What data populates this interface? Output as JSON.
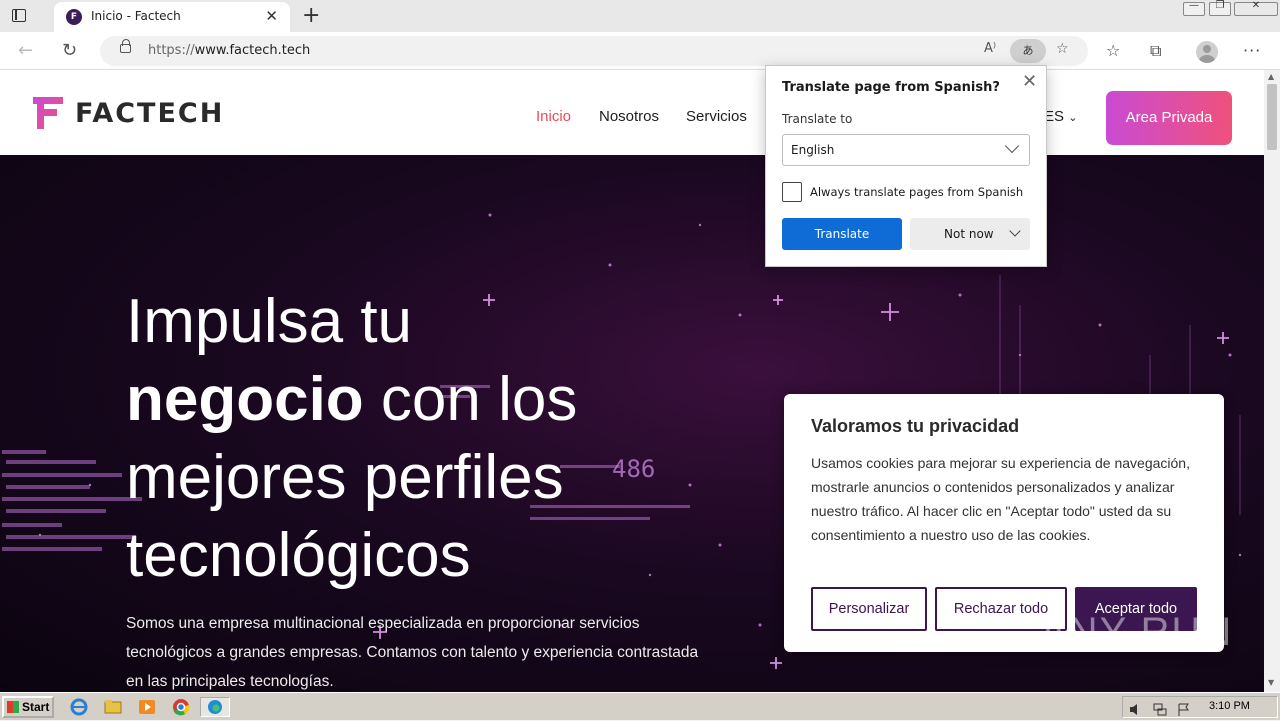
{
  "browser": {
    "tab_title": "Inicio - Factech",
    "tab_close": "✕",
    "new_tab": "+",
    "url_protocol": "https://",
    "url_host": "www.factech.tech",
    "translate_button": "あ",
    "window_minimize": "—",
    "window_restore": "❐",
    "window_close": "✕"
  },
  "site": {
    "logo_text": "FACTECH",
    "nav": [
      {
        "label": "Inicio",
        "active": true
      },
      {
        "label": "Nosotros"
      },
      {
        "label": "Servicios"
      }
    ],
    "language": "ES",
    "area_button": "Area Privada"
  },
  "hero": {
    "title_line1": "Impulsa tu",
    "title_line2_bold": "negocio",
    "title_line2_rest": " con los",
    "title_line3": "mejores perfiles",
    "title_line4": "tecnológicos",
    "subtitle": "Somos una empresa multinacional especializada en proporcionar servicios tecnológicos a grandes empresas. Contamos con talento y experiencia contrastada en las principales tecnologías.",
    "bg_number": "486"
  },
  "cookie": {
    "title": "Valoramos tu privacidad",
    "body": "Usamos cookies para mejorar su experiencia de navegación, mostrarle anuncios o contenidos personalizados y analizar nuestro tráfico. Al hacer clic en \"Aceptar todo\" usted da su consentimiento a nuestro uso de las cookies.",
    "customize": "Personalizar",
    "reject": "Rechazar todo",
    "accept": "Aceptar todo"
  },
  "translate_popup": {
    "title": "Translate page from Spanish?",
    "close": "✕",
    "translate_to_label": "Translate to",
    "language": "English",
    "always_label": "Always translate pages from Spanish",
    "always_checked": false,
    "translate_button": "Translate",
    "not_now_button": "Not now"
  },
  "watermark": "ANY RUN",
  "taskbar": {
    "start": "Start",
    "time": "3:10 PM"
  }
}
